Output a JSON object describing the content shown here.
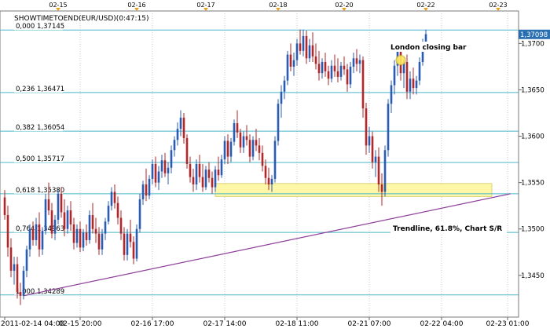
{
  "header": {
    "symbol_title": "SHOWTIMETOEND(EUR/USD)(0:47:15)"
  },
  "top_axis": {
    "labels": [
      "02-15",
      "02-16",
      "02-17",
      "02-18",
      "02-20",
      "02-22",
      "02-23"
    ]
  },
  "colors": {
    "up_candle": "#2a5cb3",
    "down_candle": "#b3262a",
    "fib_line": "#48b8c8",
    "trendline": "#8e3f9a",
    "zone_fill": "#fff7a8",
    "price_tag": "#2a6fb0",
    "marker": "#f0a020"
  },
  "annotations": {
    "london": "London closing bar",
    "trendline": "Trendline, 61.8%, Chart S/R"
  },
  "chart_data": {
    "type": "candlestick",
    "title": "SHOWTIMETOEND(EUR/USD)(0:47:15)",
    "ylim": [
      1.3405,
      1.3735
    ],
    "y_ticks": [
      1.345,
      1.35,
      1.355,
      1.36,
      1.365,
      1.37
    ],
    "y_tick_labels": [
      "1,3450",
      "1,3500",
      "1,3550",
      "1,3600",
      "1,3650",
      "1,3700"
    ],
    "x_ticks": [
      {
        "pos": 0,
        "label": "2011-02-14 04:00"
      },
      {
        "pos": 24,
        "label": "02-15 20:00"
      },
      {
        "pos": 47,
        "label": "02-16 17:00"
      },
      {
        "pos": 70,
        "label": "02-17 14:00"
      },
      {
        "pos": 93,
        "label": "02-18 11:00"
      },
      {
        "pos": 116,
        "label": "02-21 07:00"
      },
      {
        "pos": 139,
        "label": "02-22 04:00"
      },
      {
        "pos": 160,
        "label": "02-23 01:00"
      }
    ],
    "current_price": {
      "value": 1.37098,
      "label": "1,37098"
    },
    "fib_levels": [
      {
        "ratio": "0,000",
        "price": 1.37145,
        "label": "1,37145"
      },
      {
        "ratio": "0,236",
        "price": 1.36471,
        "label": "1,36471"
      },
      {
        "ratio": "0,382",
        "price": 1.36054,
        "label": "1,36054"
      },
      {
        "ratio": "0,500",
        "price": 1.35717,
        "label": "1,35717"
      },
      {
        "ratio": "0,618",
        "price": 1.3538,
        "label": "1,35380"
      },
      {
        "ratio": "0,764",
        "price": 1.34963,
        "label": "1,34963"
      },
      {
        "ratio": "1,000",
        "price": 1.34289,
        "label": "1,34289"
      }
    ],
    "trendline": {
      "from": {
        "pos": 6,
        "price": 1.3428
      },
      "to": {
        "pos": 161,
        "price": 1.3538
      }
    },
    "support_zone": {
      "from_pos": 67,
      "to_pos": 155,
      "low": 1.3535,
      "high": 1.3549
    },
    "london_marker": {
      "pos": 126,
      "price": 1.3682
    },
    "candles": [
      [
        1.3534,
        1.3542,
        1.351,
        1.3515
      ],
      [
        1.3515,
        1.3525,
        1.347,
        1.348
      ],
      [
        1.348,
        1.349,
        1.3448,
        1.3455
      ],
      [
        1.3455,
        1.347,
        1.344,
        1.3462
      ],
      [
        1.3462,
        1.347,
        1.3425,
        1.3432
      ],
      [
        1.3432,
        1.3442,
        1.3418,
        1.3428
      ],
      [
        1.3428,
        1.346,
        1.3424,
        1.3455
      ],
      [
        1.3455,
        1.3482,
        1.3448,
        1.3478
      ],
      [
        1.3478,
        1.3505,
        1.347,
        1.35
      ],
      [
        1.35,
        1.3508,
        1.3482,
        1.3488
      ],
      [
        1.3488,
        1.3512,
        1.3482,
        1.3505
      ],
      [
        1.3505,
        1.3518,
        1.347,
        1.3478
      ],
      [
        1.3478,
        1.3502,
        1.3472,
        1.3498
      ],
      [
        1.3498,
        1.3538,
        1.3494,
        1.3532
      ],
      [
        1.3532,
        1.355,
        1.3515,
        1.352
      ],
      [
        1.352,
        1.3528,
        1.349,
        1.3495
      ],
      [
        1.3495,
        1.3515,
        1.3488,
        1.351
      ],
      [
        1.351,
        1.3542,
        1.3505,
        1.3538
      ],
      [
        1.3538,
        1.3545,
        1.3512,
        1.3518
      ],
      [
        1.3518,
        1.3532,
        1.3492,
        1.35
      ],
      [
        1.35,
        1.3525,
        1.3495,
        1.352
      ],
      [
        1.352,
        1.353,
        1.3498,
        1.3505
      ],
      [
        1.3505,
        1.3512,
        1.3478,
        1.3485
      ],
      [
        1.3485,
        1.3505,
        1.348,
        1.35
      ],
      [
        1.35,
        1.3508,
        1.3475,
        1.348
      ],
      [
        1.348,
        1.35,
        1.3476,
        1.3496
      ],
      [
        1.3496,
        1.3505,
        1.3482,
        1.3488
      ],
      [
        1.3488,
        1.352,
        1.3484,
        1.3515
      ],
      [
        1.3515,
        1.3528,
        1.3495,
        1.35
      ],
      [
        1.35,
        1.3512,
        1.3485,
        1.3495
      ],
      [
        1.3495,
        1.3502,
        1.3472,
        1.3478
      ],
      [
        1.3478,
        1.35,
        1.3472,
        1.3495
      ],
      [
        1.3495,
        1.3512,
        1.3488,
        1.3508
      ],
      [
        1.3508,
        1.353,
        1.3505,
        1.3525
      ],
      [
        1.3525,
        1.3545,
        1.352,
        1.354
      ],
      [
        1.354,
        1.3548,
        1.3522,
        1.3528
      ],
      [
        1.3528,
        1.3535,
        1.3505,
        1.3512
      ],
      [
        1.3512,
        1.352,
        1.3488,
        1.3495
      ],
      [
        1.3495,
        1.3502,
        1.3466,
        1.3472
      ],
      [
        1.3472,
        1.35,
        1.3466,
        1.3495
      ],
      [
        1.3495,
        1.351,
        1.348,
        1.3486
      ],
      [
        1.3486,
        1.3492,
        1.3462,
        1.3468
      ],
      [
        1.3468,
        1.3505,
        1.3465,
        1.35
      ],
      [
        1.35,
        1.3538,
        1.3496,
        1.3532
      ],
      [
        1.3532,
        1.3552,
        1.3526,
        1.3548
      ],
      [
        1.3548,
        1.3565,
        1.353,
        1.3536
      ],
      [
        1.3536,
        1.3558,
        1.3532,
        1.3554
      ],
      [
        1.3554,
        1.3575,
        1.3548,
        1.357
      ],
      [
        1.357,
        1.3578,
        1.3545,
        1.355
      ],
      [
        1.355,
        1.3568,
        1.3542,
        1.3562
      ],
      [
        1.3562,
        1.358,
        1.3555,
        1.3574
      ],
      [
        1.3574,
        1.3582,
        1.3556,
        1.356
      ],
      [
        1.356,
        1.3572,
        1.3548,
        1.3566
      ],
      [
        1.3566,
        1.359,
        1.356,
        1.3585
      ],
      [
        1.3585,
        1.36,
        1.3578,
        1.3596
      ],
      [
        1.3596,
        1.3615,
        1.359,
        1.3608
      ],
      [
        1.3608,
        1.3628,
        1.36,
        1.362
      ],
      [
        1.362,
        1.3625,
        1.3592,
        1.3598
      ],
      [
        1.3598,
        1.3602,
        1.3565,
        1.357
      ],
      [
        1.357,
        1.3578,
        1.355,
        1.3556
      ],
      [
        1.3556,
        1.3565,
        1.354,
        1.3548
      ],
      [
        1.3548,
        1.3575,
        1.3542,
        1.357
      ],
      [
        1.357,
        1.358,
        1.355,
        1.3556
      ],
      [
        1.3556,
        1.357,
        1.354,
        1.3545
      ],
      [
        1.3545,
        1.3568,
        1.3542,
        1.3564
      ],
      [
        1.3564,
        1.3572,
        1.355,
        1.3555
      ],
      [
        1.3555,
        1.3562,
        1.3538,
        1.3545
      ],
      [
        1.3545,
        1.3568,
        1.354,
        1.3564
      ],
      [
        1.3564,
        1.3578,
        1.3552,
        1.3558
      ],
      [
        1.3558,
        1.358,
        1.3555,
        1.3575
      ],
      [
        1.3575,
        1.36,
        1.357,
        1.3595
      ],
      [
        1.3595,
        1.3602,
        1.357,
        1.3578
      ],
      [
        1.3578,
        1.3598,
        1.3572,
        1.3594
      ],
      [
        1.3594,
        1.3618,
        1.359,
        1.3614
      ],
      [
        1.3614,
        1.3628,
        1.3598,
        1.3604
      ],
      [
        1.3604,
        1.3608,
        1.3582,
        1.3588
      ],
      [
        1.3588,
        1.3605,
        1.3582,
        1.36
      ],
      [
        1.36,
        1.3612,
        1.359,
        1.3596
      ],
      [
        1.3596,
        1.3602,
        1.3572,
        1.3578
      ],
      [
        1.3578,
        1.36,
        1.3574,
        1.3596
      ],
      [
        1.3596,
        1.3608,
        1.3584,
        1.359
      ],
      [
        1.359,
        1.3598,
        1.3574,
        1.3582
      ],
      [
        1.3582,
        1.359,
        1.3562,
        1.3568
      ],
      [
        1.3568,
        1.3575,
        1.3548,
        1.3555
      ],
      [
        1.3555,
        1.3566,
        1.3542,
        1.3548
      ],
      [
        1.3548,
        1.3558,
        1.354,
        1.3554
      ],
      [
        1.3554,
        1.36,
        1.355,
        1.3595
      ],
      [
        1.3595,
        1.364,
        1.359,
        1.3635
      ],
      [
        1.3635,
        1.3655,
        1.362,
        1.3648
      ],
      [
        1.3648,
        1.3665,
        1.364,
        1.366
      ],
      [
        1.366,
        1.3692,
        1.3655,
        1.3688
      ],
      [
        1.3688,
        1.37,
        1.367,
        1.3675
      ],
      [
        1.3675,
        1.369,
        1.3665,
        1.3682
      ],
      [
        1.3682,
        1.3705,
        1.3676,
        1.37
      ],
      [
        1.37,
        1.3715,
        1.3688,
        1.3692
      ],
      [
        1.3692,
        1.3715,
        1.3686,
        1.3708
      ],
      [
        1.3708,
        1.3714,
        1.3678,
        1.3684
      ],
      [
        1.3684,
        1.3705,
        1.368,
        1.3698
      ],
      [
        1.3698,
        1.3712,
        1.368,
        1.3686
      ],
      [
        1.3686,
        1.37,
        1.3672,
        1.3678
      ],
      [
        1.3678,
        1.3692,
        1.366,
        1.3668
      ],
      [
        1.3668,
        1.3684,
        1.3662,
        1.368
      ],
      [
        1.368,
        1.369,
        1.3664,
        1.367
      ],
      [
        1.367,
        1.3676,
        1.3655,
        1.3662
      ],
      [
        1.3662,
        1.3682,
        1.3658,
        1.3676
      ],
      [
        1.3676,
        1.3688,
        1.3664,
        1.367
      ],
      [
        1.367,
        1.3684,
        1.3658,
        1.3664
      ],
      [
        1.3664,
        1.368,
        1.366,
        1.3676
      ],
      [
        1.3676,
        1.3686,
        1.3666,
        1.3672
      ],
      [
        1.3672,
        1.3678,
        1.3648,
        1.3656
      ],
      [
        1.3656,
        1.368,
        1.3652,
        1.3675
      ],
      [
        1.3675,
        1.369,
        1.3668,
        1.3684
      ],
      [
        1.3684,
        1.3694,
        1.367,
        1.3678
      ],
      [
        1.3678,
        1.3688,
        1.3668,
        1.3682
      ],
      [
        1.3682,
        1.3686,
        1.362,
        1.363
      ],
      [
        1.363,
        1.3636,
        1.358,
        1.359
      ],
      [
        1.359,
        1.361,
        1.3582,
        1.36
      ],
      [
        1.36,
        1.3605,
        1.3565,
        1.3572
      ],
      [
        1.3572,
        1.3585,
        1.3556,
        1.3578
      ],
      [
        1.3578,
        1.3588,
        1.354,
        1.3548
      ],
      [
        1.3548,
        1.356,
        1.3525,
        1.354
      ],
      [
        1.354,
        1.359,
        1.3535,
        1.3585
      ],
      [
        1.3585,
        1.364,
        1.3578,
        1.3635
      ],
      [
        1.3635,
        1.366,
        1.3625,
        1.3655
      ],
      [
        1.3655,
        1.3682,
        1.3645,
        1.3676
      ],
      [
        1.3676,
        1.37,
        1.3665,
        1.3692
      ],
      [
        1.3692,
        1.3698,
        1.366,
        1.3668
      ],
      [
        1.3668,
        1.3685,
        1.3652,
        1.368
      ],
      [
        1.368,
        1.3688,
        1.364,
        1.3648
      ],
      [
        1.3648,
        1.367,
        1.364,
        1.3662
      ],
      [
        1.3662,
        1.3674,
        1.3645,
        1.3652
      ],
      [
        1.3652,
        1.3665,
        1.3645,
        1.366
      ],
      [
        1.366,
        1.3685,
        1.3655,
        1.368
      ],
      [
        1.368,
        1.3705,
        1.3676,
        1.37
      ],
      [
        1.37,
        1.3715,
        1.3692,
        1.371
      ]
    ]
  }
}
